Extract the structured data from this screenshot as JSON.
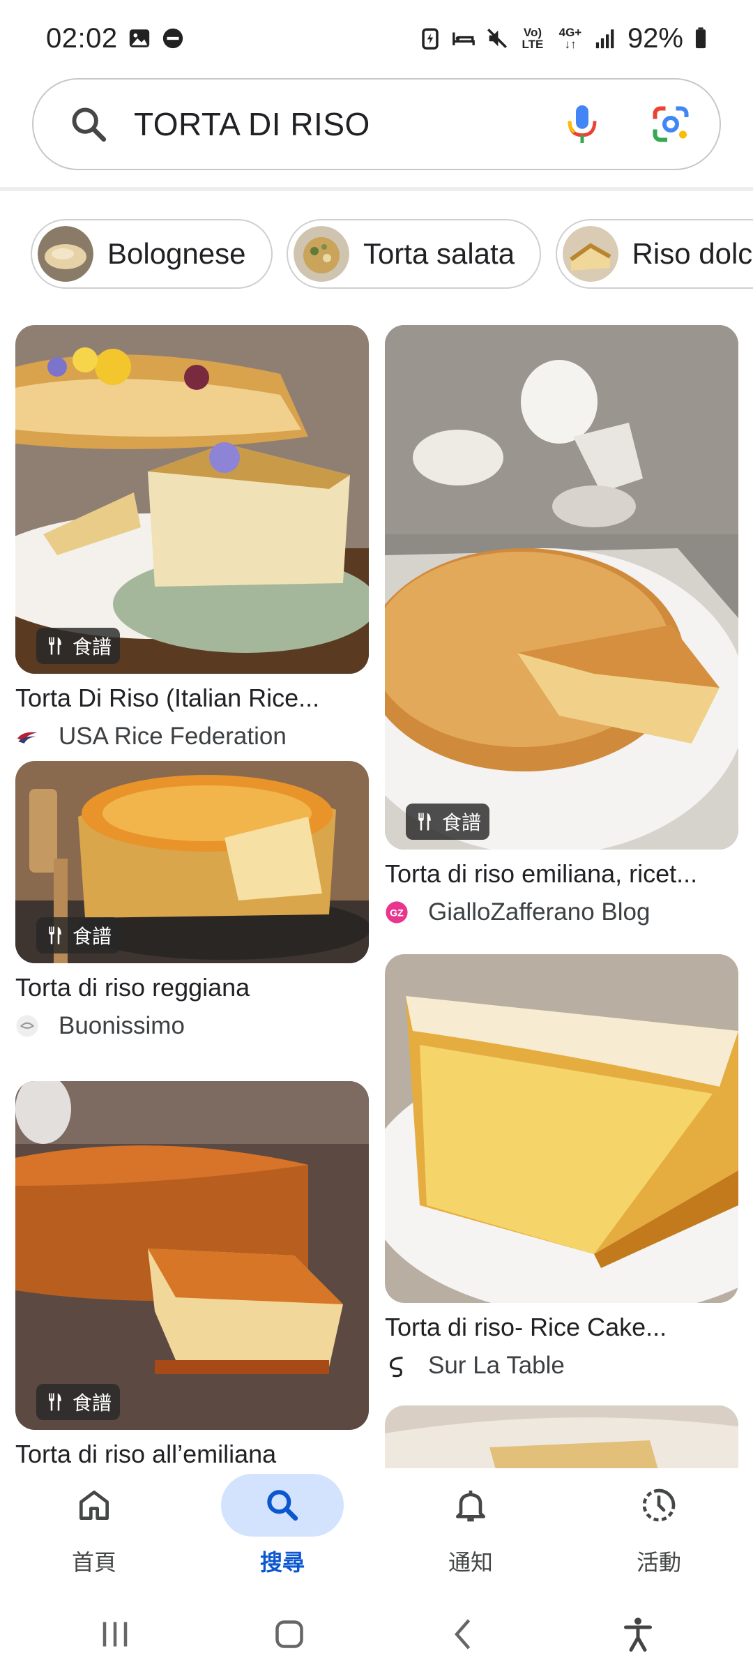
{
  "status_bar": {
    "time": "02:02",
    "network_top": "Vo)",
    "network_bottom": "LTE",
    "net_type": "4G+",
    "battery": "92%"
  },
  "search": {
    "query": "TORTA DI RISO",
    "icons": [
      "search-icon",
      "mic-icon",
      "lens-icon"
    ]
  },
  "chips": [
    {
      "label": "Bolognese"
    },
    {
      "label": "Torta salata"
    },
    {
      "label": "Riso dolce"
    }
  ],
  "results": [
    {
      "title": "Torta Di Riso (Italian Rice...",
      "source": "USA Rice Federation",
      "badge": "食譜"
    },
    {
      "title": "Torta di riso emiliana, ricet...",
      "source": "GialloZafferano Blog",
      "badge": "食譜"
    },
    {
      "title": "Torta di riso reggiana",
      "source": "Buonissimo",
      "badge": "食譜"
    },
    {
      "title": "Torta di riso- Rice Cake...",
      "source": "Sur La Table",
      "badge": ""
    },
    {
      "title": "Torta di riso all’emiliana",
      "source": "",
      "badge": "食譜"
    }
  ],
  "bottom_nav": [
    {
      "label": "首頁",
      "icon": "home-icon",
      "active": false
    },
    {
      "label": "搜尋",
      "icon": "search-icon",
      "active": true
    },
    {
      "label": "通知",
      "icon": "bell-icon",
      "active": false
    },
    {
      "label": "活動",
      "icon": "activity-icon",
      "active": false
    }
  ],
  "colors": {
    "accent": "#0b57d0",
    "active_pill": "#d3e3fd",
    "text": "#202124"
  }
}
